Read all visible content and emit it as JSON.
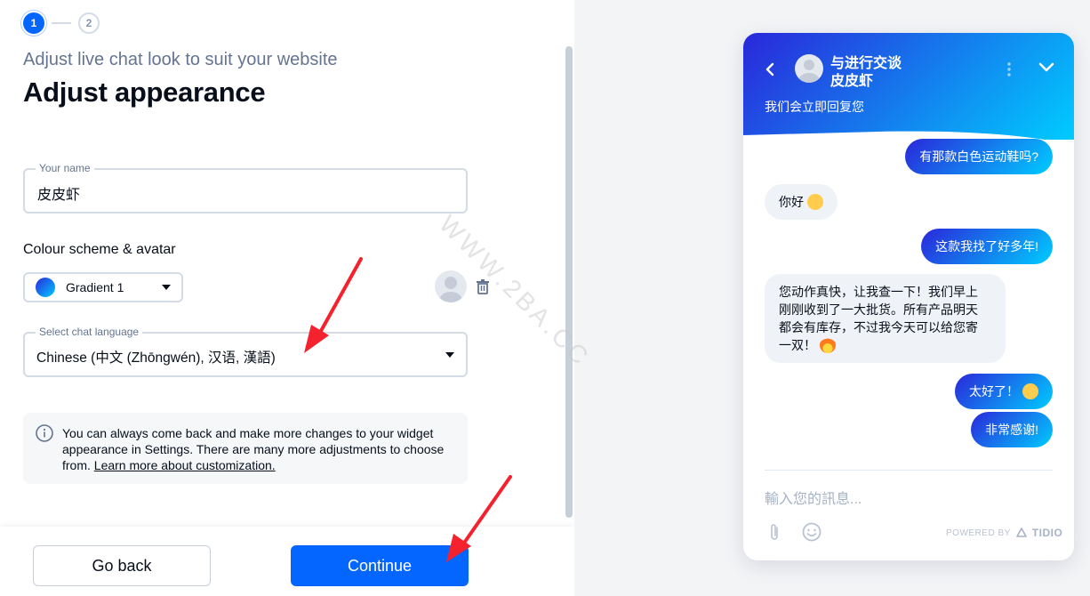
{
  "stepper": {
    "step1": "1",
    "step2": "2"
  },
  "header": {
    "subtitle": "Adjust live chat look to suit your website",
    "title": "Adjust appearance"
  },
  "name_field": {
    "label": "Your name",
    "value": "皮皮虾"
  },
  "colour_section": {
    "label": "Colour scheme & avatar",
    "scheme_value": "Gradient 1"
  },
  "language_field": {
    "label": "Select chat language",
    "value": "Chinese (中文 (Zhōngwén), 汉语, 漢語)"
  },
  "info": {
    "text": "You can always come back and make more changes to your widget appearance in Settings. There are many more adjustments to choose from.",
    "link": "Learn more about customization."
  },
  "footer": {
    "back_label": "Go back",
    "continue_label": "Continue"
  },
  "widget": {
    "title_line1": "与进行交谈",
    "title_line2": "皮皮虾",
    "reply_text": "我们会立即回复您",
    "messages": [
      {
        "from": "visitor",
        "text": "有那款白色运动鞋吗?"
      },
      {
        "from": "operator",
        "text": "你好"
      },
      {
        "from": "visitor",
        "text": "这款我找了好多年!"
      },
      {
        "from": "operator",
        "line1": "您动作真快，让我查一下！我们早上",
        "line2": "刚刚收到了一大批货。所有产品明天",
        "line3": "都会有库存，不过我今天可以给您寄",
        "line4": "一双！"
      },
      {
        "from": "visitor",
        "text": "太好了！"
      },
      {
        "from": "visitor",
        "text": "非常感谢!"
      }
    ],
    "input_placeholder": "輸入您的訊息...",
    "powered_by": "POWERED BY",
    "brand": "TIDIO"
  },
  "watermark": "WWW.2BA.CC",
  "colors": {
    "accent": "#0566ff",
    "gradient_start": "#2a27da",
    "gradient_end": "#00ccff"
  }
}
